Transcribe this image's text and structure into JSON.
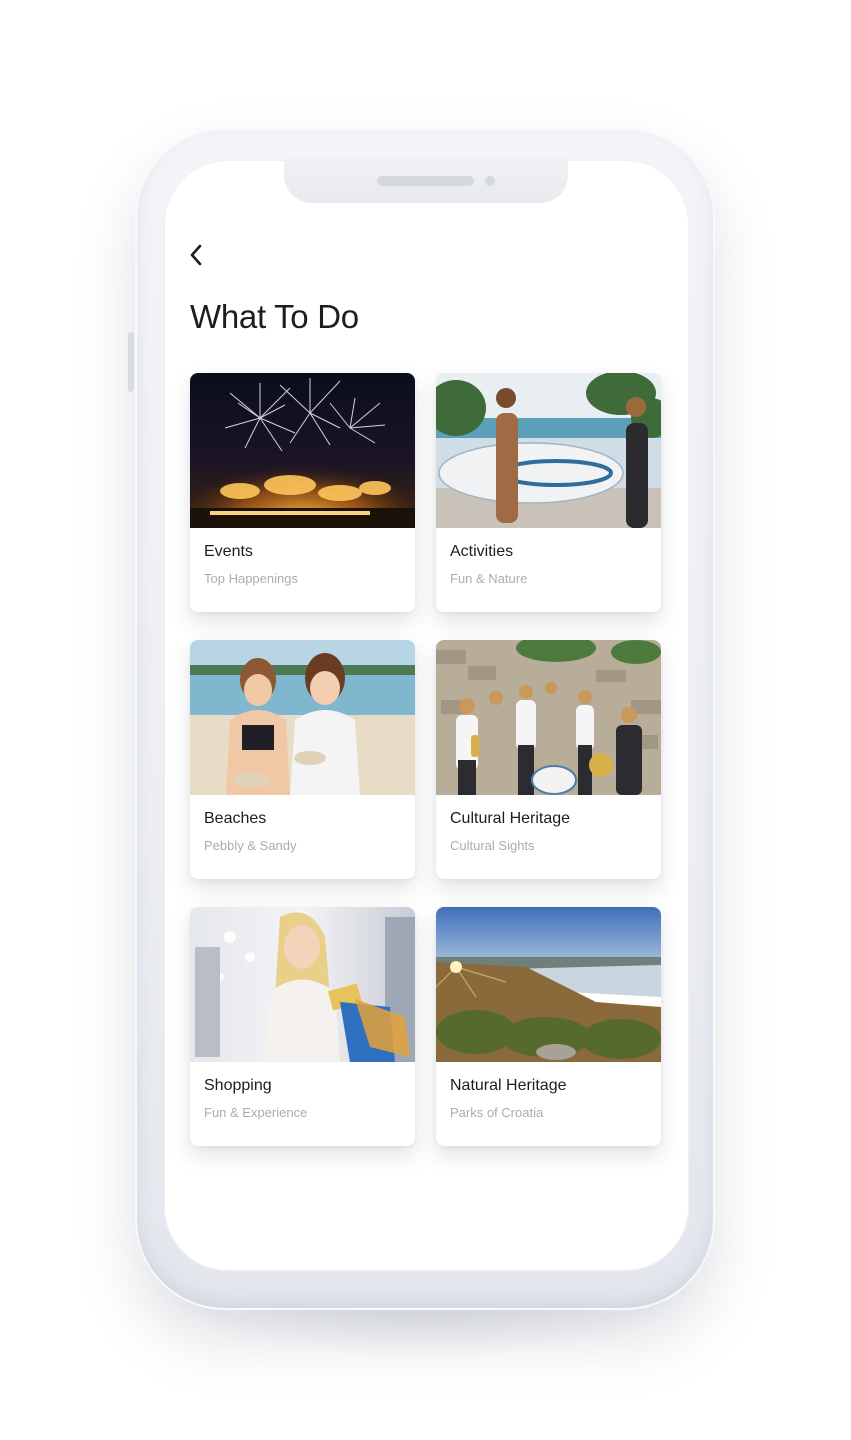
{
  "page": {
    "title": "What To Do"
  },
  "nav": {
    "back_icon": "chevron-left-icon"
  },
  "colors": {
    "text_primary": "#1d1d1f",
    "text_secondary": "#a7acb6",
    "background": "#ffffff",
    "device_frame": "#eceef3"
  },
  "cards": [
    {
      "title": "Events",
      "subtitle": "Top Happenings",
      "image": "fireworks-image"
    },
    {
      "title": "Activities",
      "subtitle": "Fun & Nature",
      "image": "surfers-image"
    },
    {
      "title": "Beaches",
      "subtitle": "Pebbly & Sandy",
      "image": "beach-kids-image"
    },
    {
      "title": "Cultural Heritage",
      "subtitle": "Cultural Sights",
      "image": "brass-band-image"
    },
    {
      "title": "Shopping",
      "subtitle": "Fun & Experience",
      "image": "shopping-woman-image"
    },
    {
      "title": "Natural Heritage",
      "subtitle": "Parks of Croatia",
      "image": "landscape-image"
    }
  ]
}
